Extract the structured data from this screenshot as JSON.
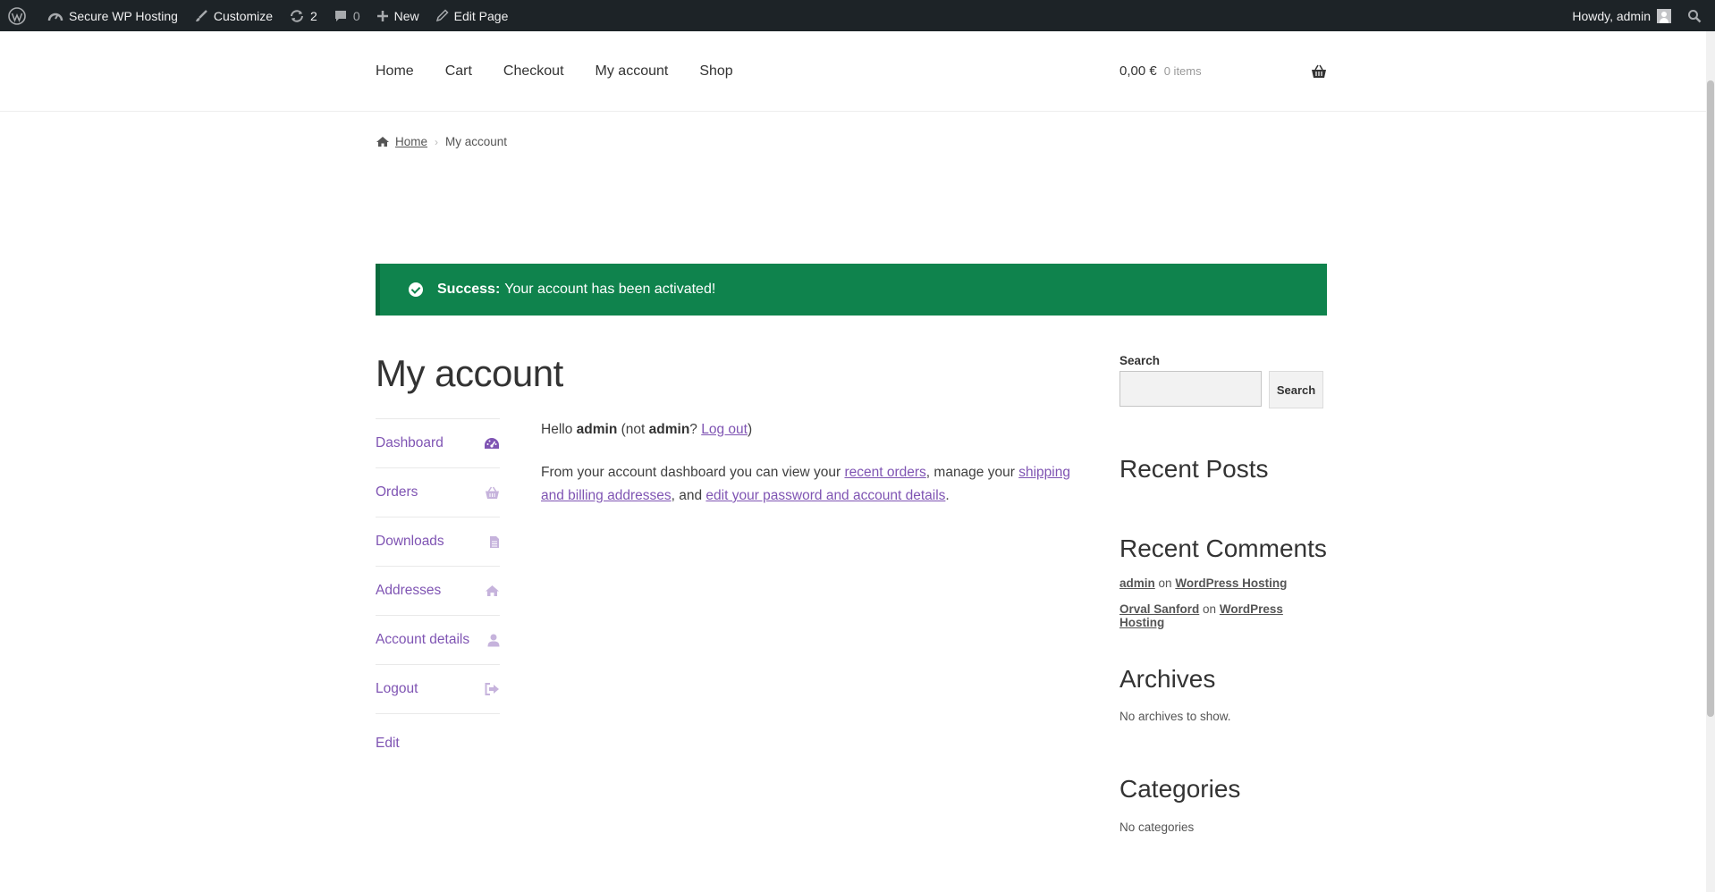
{
  "admin_bar": {
    "site_name": "Secure WP Hosting",
    "customize": "Customize",
    "updates_count": "2",
    "comments_count": "0",
    "new_label": "New",
    "edit_page": "Edit Page",
    "greeting": "Howdy, admin"
  },
  "nav": {
    "items": [
      "Home",
      "Cart",
      "Checkout",
      "My account",
      "Shop"
    ]
  },
  "cart": {
    "amount": "0,00 €",
    "items": "0 items"
  },
  "breadcrumb": {
    "home": "Home",
    "current": "My account"
  },
  "notice": {
    "strong": "Success:",
    "message": "Your account has been activated!"
  },
  "page_title": "My account",
  "account_nav": {
    "items": [
      {
        "label": "Dashboard",
        "icon": "dashboard-icon"
      },
      {
        "label": "Orders",
        "icon": "basket-icon"
      },
      {
        "label": "Downloads",
        "icon": "file-icon"
      },
      {
        "label": "Addresses",
        "icon": "home-icon"
      },
      {
        "label": "Account details",
        "icon": "user-icon"
      },
      {
        "label": "Logout",
        "icon": "logout-icon"
      }
    ],
    "edit": "Edit"
  },
  "content": {
    "hello": "Hello",
    "user": "admin",
    "not_prefix": "(not",
    "not_user": "admin",
    "q": "?",
    "logout": "Log out",
    "close": ")",
    "dash_1": "From your account dashboard you can view your",
    "recent_orders": "recent orders",
    "dash_2": ", manage your",
    "addresses": "shipping and billing addresses",
    "dash_3": ", and",
    "password": "edit your password and account details",
    "dash_4": "."
  },
  "sidebar": {
    "search_label": "Search",
    "search_button": "Search",
    "recent_posts": "Recent Posts",
    "recent_comments": "Recent Comments",
    "comments": [
      {
        "author": "admin",
        "on": "on",
        "post": "WordPress Hosting"
      },
      {
        "author": "Orval Sanford",
        "on": "on",
        "post": "WordPress Hosting"
      }
    ],
    "archives": "Archives",
    "archives_empty": "No archives to show.",
    "categories": "Categories",
    "categories_empty": "No categories"
  },
  "colors": {
    "admin_bar": "#1d2327",
    "success": "#0f834d",
    "accent": "#7f54b3"
  }
}
